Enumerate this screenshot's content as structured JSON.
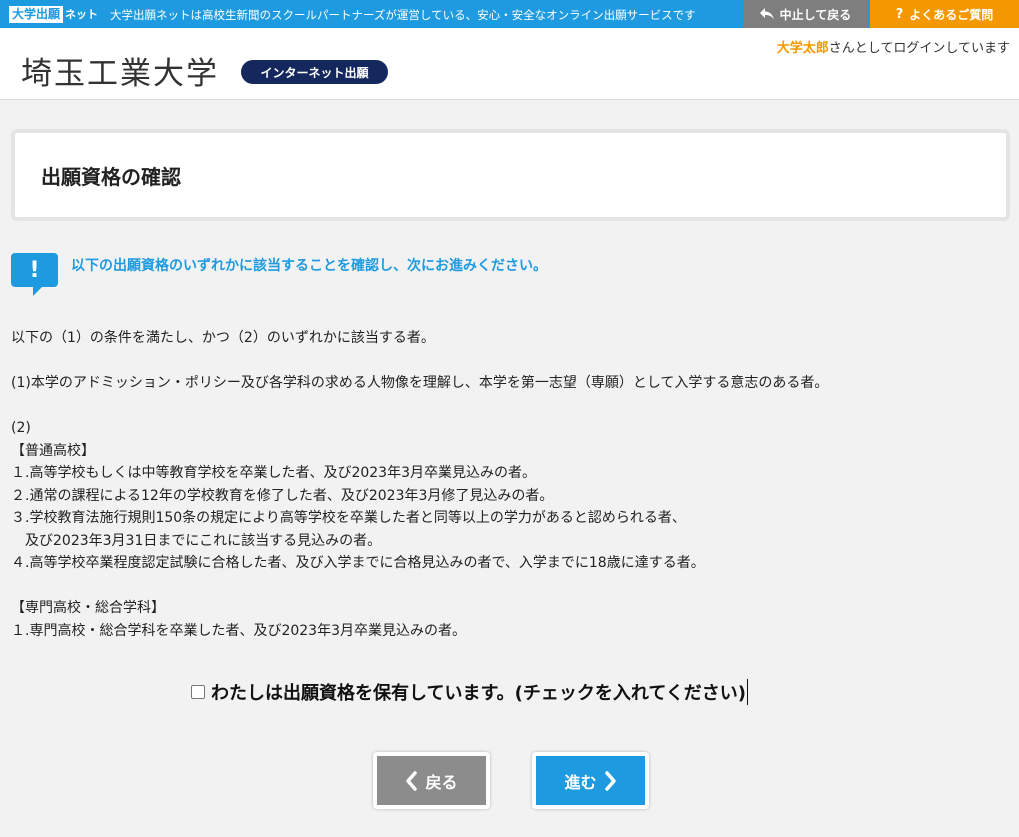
{
  "topbar": {
    "logo_box": "大学出願",
    "logo_suffix": "ネット",
    "description": "大学出願ネットは高校生新聞のスクールパートナーズが運営している、安心・安全なオンライン出願サービスです",
    "stop_button": "中止して戻る",
    "faq_button": "よくあるご質問",
    "colors": {
      "bar": "#1e9be0",
      "stop": "#7e7e7e",
      "faq": "#f39800"
    }
  },
  "header": {
    "university": "埼玉工業大学",
    "badge": "インターネット出願",
    "login_user": "大学太郎",
    "login_suffix": "さんとしてログインしています"
  },
  "page": {
    "title": "出願資格の確認",
    "notice": "以下の出願資格のいずれかに該当することを確認し、次にお進みください。"
  },
  "qualifications": {
    "intro": "以下の（1）の条件を満たし、かつ（2）のいずれかに該当する者。",
    "cond1": "(1)本学のアドミッション・ポリシー及び各学科の求める人物像を理解し、本学を第一志望（専願）として入学する意志のある者。",
    "cond2_label": "(2)",
    "section_general": "【普通高校】",
    "general_1": "１.高等学校もしくは中等教育学校を卒業した者、及び2023年3月卒業見込みの者。",
    "general_2": "２.通常の課程による12年の学校教育を修了した者、及び2023年3月修了見込みの者。",
    "general_3": "３.学校教育法施行規則150条の規定により高等学校を卒業した者と同等以上の学力があると認められる者、",
    "general_3b": "　及び2023年3月31日までにこれに該当する見込みの者。",
    "general_4": "４.高等学校卒業程度認定試験に合格した者、及び入学までに合格見込みの者で、入学までに18歳に達する者。",
    "section_special": "【専門高校・総合学科】",
    "special_1": "１.専門高校・総合学科を卒業した者、及び2023年3月卒業見込みの者。"
  },
  "agree": {
    "label": "わたしは出願資格を保有しています。(チェックを入れてください)",
    "checked": false
  },
  "nav": {
    "back": "戻る",
    "next": "進む"
  }
}
